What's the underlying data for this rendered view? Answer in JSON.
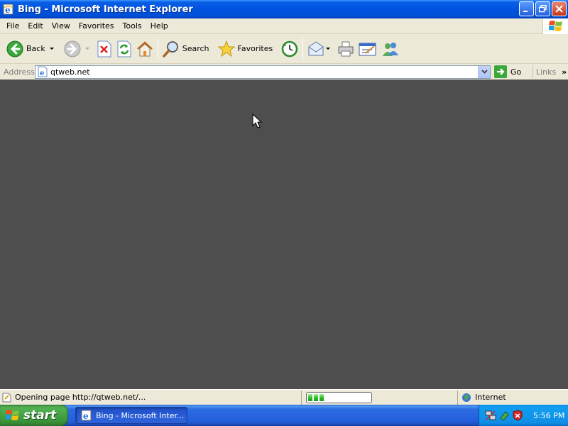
{
  "window": {
    "title": "Bing - Microsoft Internet Explorer"
  },
  "menu": {
    "items": [
      "File",
      "Edit",
      "View",
      "Favorites",
      "Tools",
      "Help"
    ]
  },
  "toolbar": {
    "back_label": "Back",
    "search_label": "Search",
    "favorites_label": "Favorites"
  },
  "address": {
    "label": "Address",
    "value": "qtweb.net",
    "go_label": "Go",
    "links_label": "Links"
  },
  "status": {
    "message": "Opening page http://qtweb.net/...",
    "progress_chunks_filled": 3,
    "zone": "Internet"
  },
  "taskbar": {
    "start_label": "start",
    "task_label": "Bing - Microsoft Inter...",
    "clock": "5:56 PM"
  },
  "colors": {
    "content_background": "#4e4e4e",
    "titlebar_blue": "#0053e1",
    "start_green": "#3c9a3c"
  }
}
